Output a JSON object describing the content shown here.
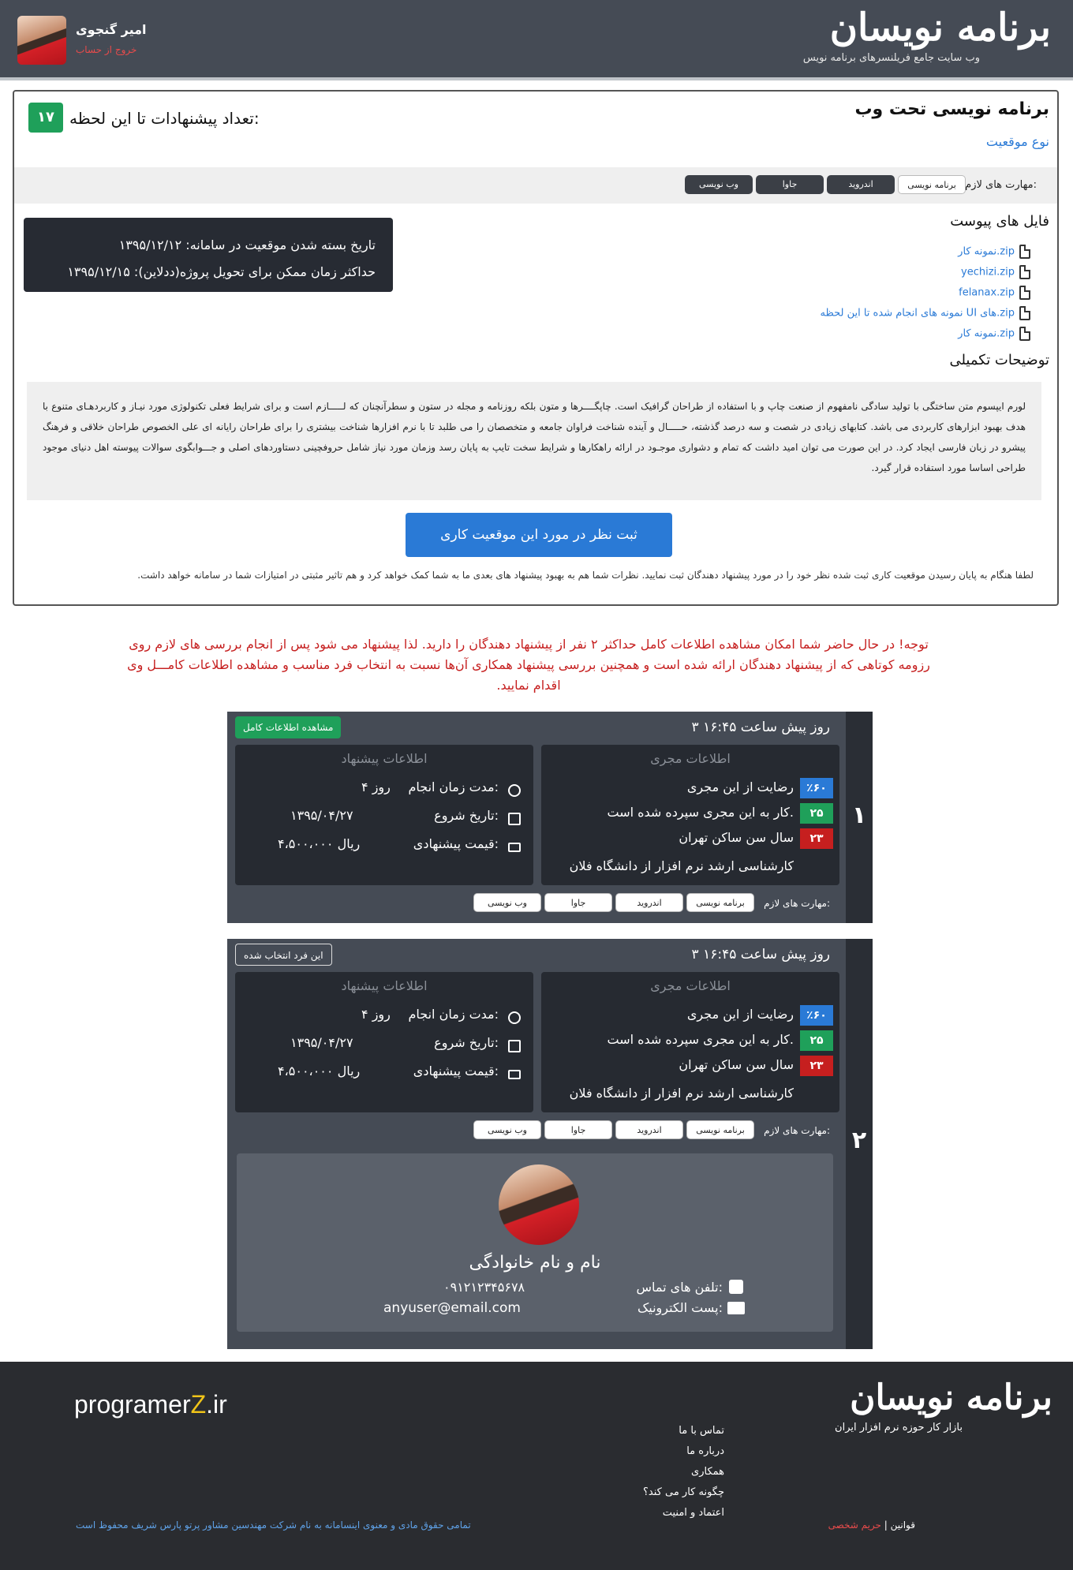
{
  "header": {
    "logo": "برنامه نویسان",
    "tagline": "وب سایت جامع فریلنسرهای برنامه نویس",
    "user_name": "امیر گنجوی",
    "logout": "خروج از حساب"
  },
  "project": {
    "title": "برنامه نویسی تحت وب",
    "type_link": "نوع موقعیت",
    "bids_label": "تعداد پیشنهادات تا این لحظه:",
    "bids_count": "۱۷",
    "skills_label": "مهارت های لازم:",
    "skills": [
      "برنامه نویسی",
      "اندروید",
      "جاوا",
      "وب نویسی"
    ],
    "files_title": "فایل های پیوست",
    "files": [
      "نمونه کار.zip",
      "yechizi.zip",
      "felanax.zip",
      "نمونه های انجام شده تا این لحظه UI های.zip",
      "نمونه کار.zip"
    ],
    "close_date": "تاریخ بسته شدن موقعیت در سامانه: ۱۳۹۵/۱۲/۱۲",
    "deadline": "حداکثر زمان ممکن برای تحویل پروژه(ددلاین): ۱۳۹۵/۱۲/۱۵",
    "desc_title": "توضیحات تکمیلی",
    "description": "لورم ایپسوم متن ساختگی با تولید سادگی نامفهوم از صنعت چاپ و با استفاده از طراحان گرافیک است. چاپگــــرها و متون بلکه روزنامه و مجله در ستون و سطرآنچنان که لـــــازم است و برای شرایط فعلی تکنولوژی مورد نیـاز  و کاربردهـای متنوع با هدف بهبود ابزارهای کاربردی می باشد. کتابهای زیادی در شصت و سه درصد گذشته، حـــــال و آینده شناخت فراوان جامعه و متخصصان را می طلبد تا با نرم افزارها شناخت بیشتری را برای طراحان رایانه ای علی الخصوص  طراحان خلاقی و فرهنگ پیشرو در زبان فارسی ایجاد کرد. در این صورت می توان امید داشت که تمام و دشواری موجـود در ارائه  راهکارها و شرایط سخت تایپ به پایان رسد وزمان مورد نیاز شامل حروفچینی دستاوردهای اصلی و جـــوابگوی سوالات پیوسته اهل دنیای موجود طراحی اساسا مورد استفاده قرار گیرد.",
    "submit_button": "ثبت نظر در مورد این موقعیت کاری",
    "submit_note": "لطفا هنگام به پایان رسیدن موقعیت کاری ثبت شده نظر خود را در مورد پیشنهاد دهندگان ثبت نمایید. نظرات شما هم به بهبود پیشنهاد های بعدی ما به شما کمک خواهد کرد و هم تاثیر مثبتی در امتیازات شما در سامانه خواهد داشت."
  },
  "warning": {
    "line1": "توجه! در حال حاضر شما امکان مشاهده اطلاعات کامل حداکثر  ۲  نفر از پیشنهاد دهندگان را دارید. لذا پیشنهاد می شود پس از انجام بررسی های لازم روی",
    "line2": "رزومه کوتاهی که از پیشنهاد دهندگان ارائه شده است و همچنین بررسی پیشنهاد همکاری آن‌ها نسبت به انتخاب فرد مناسب و مشاهده اطلاعات کامـــل وی",
    "line3": "اقدام نمایید."
  },
  "bids": [
    {
      "number": "۱",
      "date": "۳ روز پیش ساعت ۱۶:۴۵",
      "action": "مشاهده اطلاعات کامل",
      "executor_title": "اطلاعات مجری",
      "satisfaction_value": "٪۶۰",
      "satisfaction_label": "رضایت از این مجری",
      "jobs_value": "۲۵",
      "jobs_label": "کار به این مجری سپرده شده است.",
      "age_value": "۲۳",
      "age_label": "سال سن ساکن تهران",
      "education": "کارشناسی ارشد نرم افزار از دانشگاه فلان",
      "offer_title": "اطلاعات پیشنهاد",
      "duration_label": "مدت زمان انجام:",
      "duration_value": "۴ روز",
      "start_label": "تاریخ شروع:",
      "start_value": "۱۳۹۵/۰۴/۲۷",
      "price_label": "قیمت پیشنهادی:",
      "price_value": "۴،۵۰۰،۰۰۰ ریال",
      "skills_label": "مهارت های لازم:",
      "skills": [
        "برنامه نویسی",
        "اندروید",
        "جاوا",
        "وب نویسی"
      ]
    },
    {
      "number": "۲",
      "date": "۳ روز پیش ساعت ۱۶:۴۵",
      "action": "این فرد انتخاب شده",
      "executor_title": "اطلاعات مجری",
      "satisfaction_value": "٪۶۰",
      "satisfaction_label": "رضایت از این مجری",
      "jobs_value": "۲۵",
      "jobs_label": "کار به این مجری سپرده شده است.",
      "age_value": "۲۳",
      "age_label": "سال سن ساکن تهران",
      "education": "کارشناسی ارشد نرم افزار از دانشگاه فلان",
      "offer_title": "اطلاعات پیشنهاد",
      "duration_label": "مدت زمان انجام:",
      "duration_value": "۴ روز",
      "start_label": "تاریخ شروع:",
      "start_value": "۱۳۹۵/۰۴/۲۷",
      "price_label": "قیمت پیشنهادی:",
      "price_value": "۴،۵۰۰،۰۰۰ ریال",
      "skills_label": "مهارت های لازم:",
      "skills": [
        "برنامه نویسی",
        "اندروید",
        "جاوا",
        "وب نویسی"
      ],
      "profile": {
        "name": "نام و نام خانوادگی",
        "phone_label": "تلفن های تماس:",
        "phone": "۰۹۱۲۱۲۳۴۵۶۷۸",
        "email_label": "پست الکترونیک:",
        "email": "anyuser@email.com"
      }
    }
  ],
  "footer": {
    "logo": "برنامه نویسان",
    "tagline": "بازار کار حوزه نرم افزار ایران",
    "links": [
      "تماس با ما",
      "درباره ما",
      "همکاری",
      "چگونه کار می کند؟",
      "اعتماد و امنیت"
    ],
    "brand_prefix": "programer",
    "brand_z": "Z",
    "brand_suffix": ".ir",
    "copyright": "تمامی حقوق مادی و معنوی اینسامانه به نام شرکت مهندسین مشاور پرتو پارس شریف محفوظ است",
    "laws": "قوانین",
    "privacy": "حریم شخصی"
  }
}
